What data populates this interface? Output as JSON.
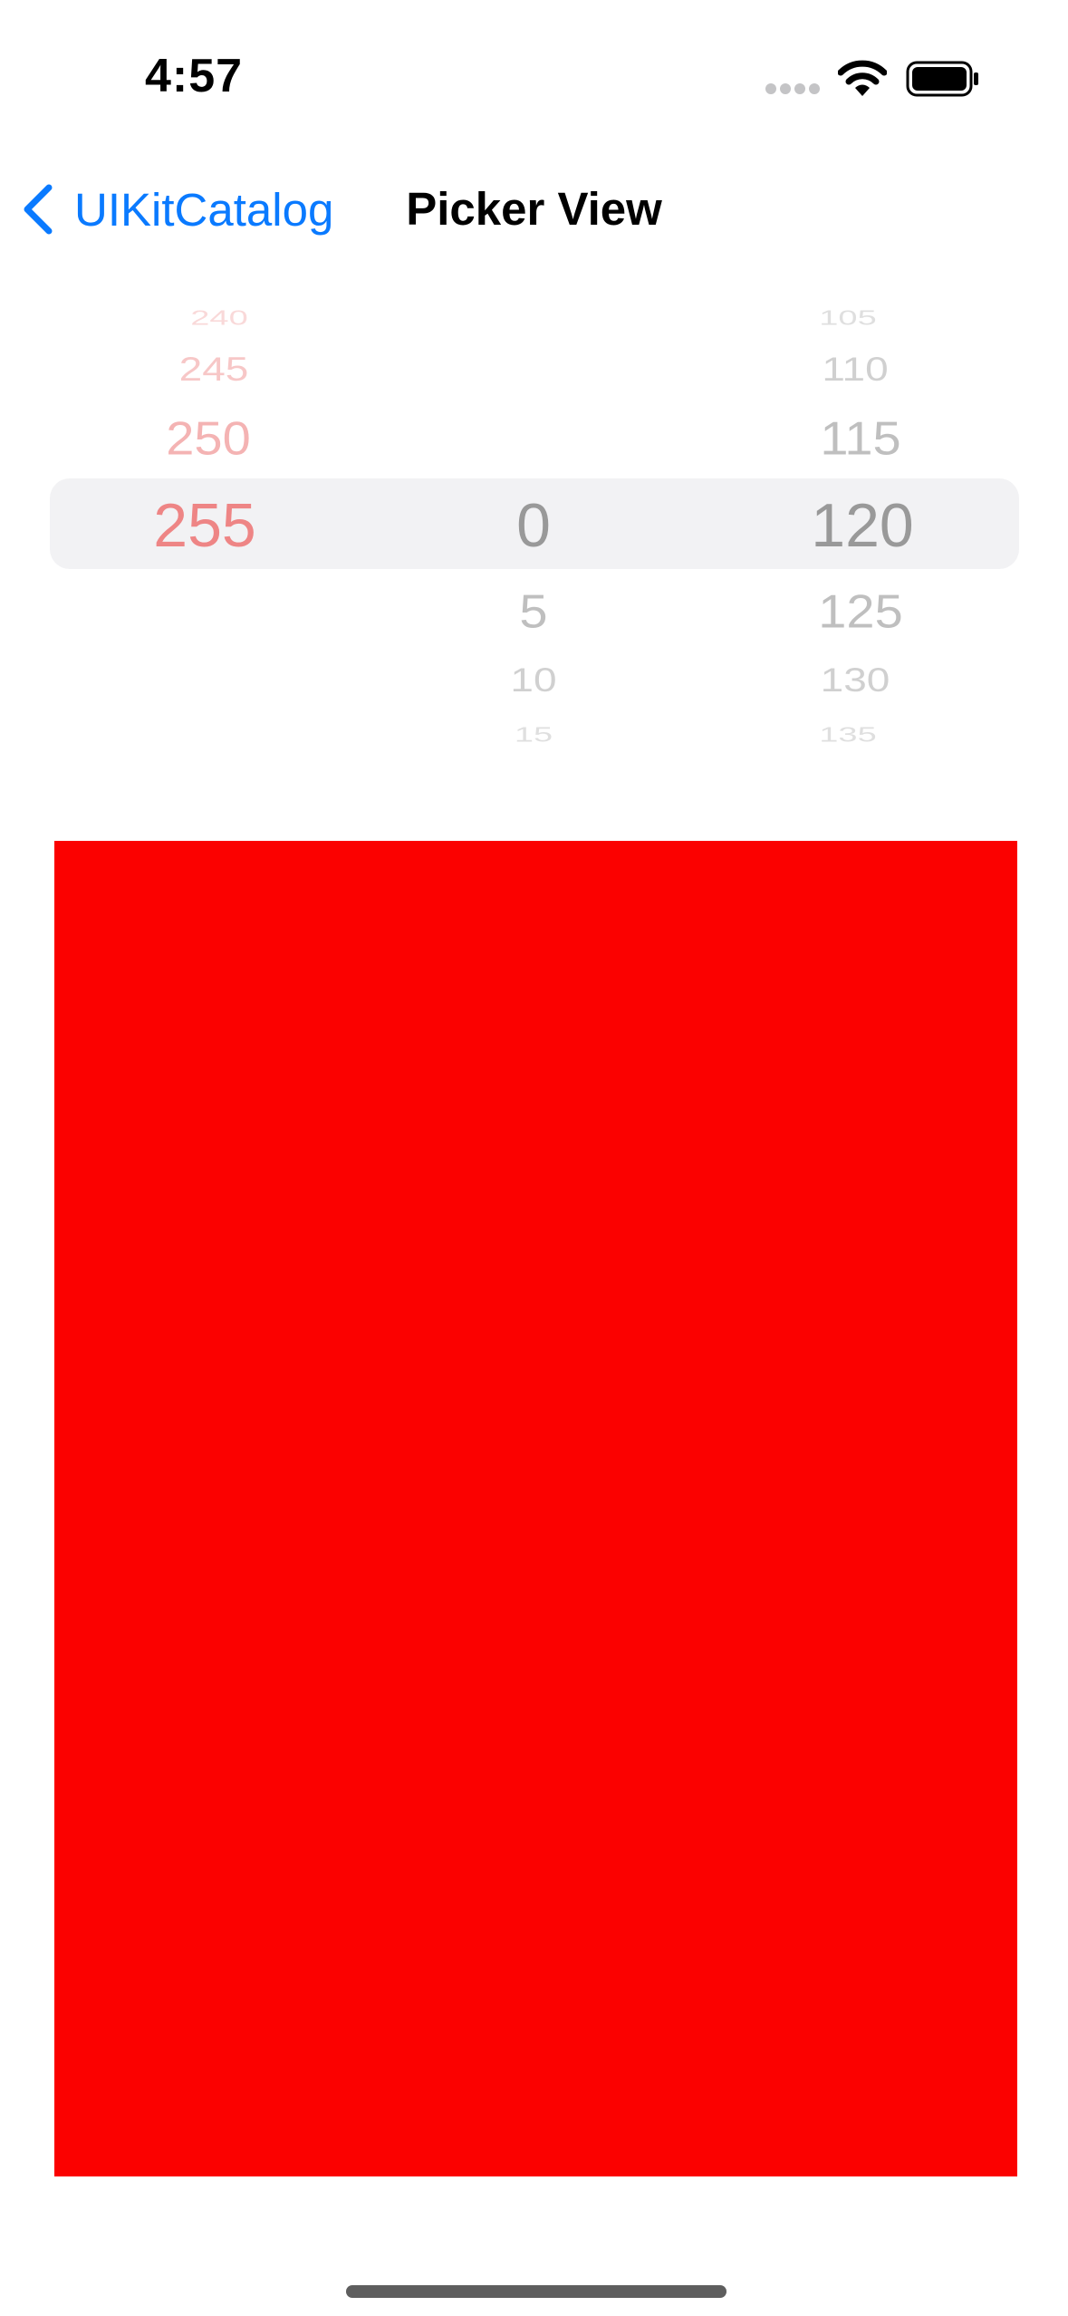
{
  "status_bar": {
    "time": "4:57",
    "icons": [
      "signal-dots-icon",
      "wifi-icon",
      "battery-icon"
    ]
  },
  "nav": {
    "back_label": "UIKitCatalog",
    "title": "Picker View"
  },
  "picker": {
    "columns": [
      {
        "name": "red",
        "selected": "255",
        "visible_above": [
          "240",
          "245",
          "250"
        ],
        "visible_below": []
      },
      {
        "name": "green",
        "selected": "0",
        "visible_above": [],
        "visible_below": [
          "5",
          "10",
          "15"
        ]
      },
      {
        "name": "blue",
        "selected": "120",
        "visible_above": [
          "105",
          "110",
          "115"
        ],
        "visible_below": [
          "125",
          "130",
          "135"
        ]
      }
    ]
  },
  "swatch": {
    "color": "#fb0100"
  },
  "colors": {
    "accent": "#0a7aff",
    "red_column_text": "#ee8585",
    "gray_column_text": "#999999",
    "highlight": "#f2f2f4"
  }
}
